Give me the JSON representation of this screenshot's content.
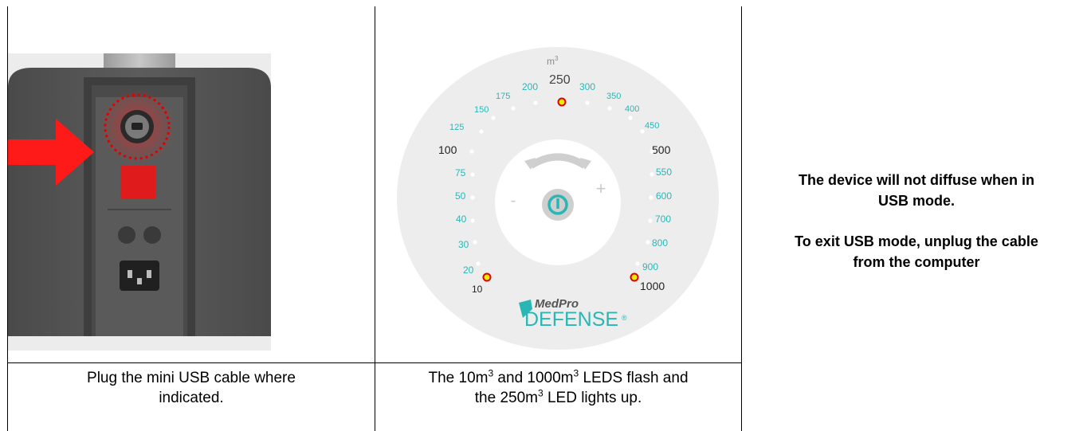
{
  "left_cell": {
    "caption_line1": "Plug the mini USB cable where",
    "caption_line2": "indicated.",
    "image_icon": "device-back-usb-port-photo"
  },
  "middle_cell": {
    "caption_pre1": "The 10m",
    "caption_sup1": "3",
    "caption_mid1": " and 1000m",
    "caption_sup2": "3",
    "caption_post1": " LEDS flash and",
    "caption_pre2": "the 250m",
    "caption_sup3": "3",
    "caption_post2": " LED lights up.",
    "dial": {
      "unit": "m",
      "unit_sup": "3",
      "minus": "-",
      "plus": "+",
      "brand_top": "MedPro",
      "brand_bottom": "DEFENSE",
      "brand_mark": "®",
      "labels": {
        "v10": "10",
        "v20": "20",
        "v30": "30",
        "v40": "40",
        "v50": "50",
        "v75": "75",
        "v100": "100",
        "v125": "125",
        "v150": "150",
        "v175": "175",
        "v200": "200",
        "v250": "250",
        "v300": "300",
        "v350": "350",
        "v400": "400",
        "v450": "450",
        "v500": "500",
        "v550": "550",
        "v600": "600",
        "v700": "700",
        "v800": "800",
        "v900": "900",
        "v1000": "1000"
      },
      "lit_leds": [
        "10",
        "250",
        "1000"
      ],
      "accent_color": "#2bb6b6",
      "led_color": "#e8f000",
      "led_ring_color": "#e00000"
    }
  },
  "right_cell": {
    "line1": "The device will not diffuse when in",
    "line2": "USB mode.",
    "line3": "To exit USB mode, unplug the cable",
    "line4": "from the computer"
  }
}
